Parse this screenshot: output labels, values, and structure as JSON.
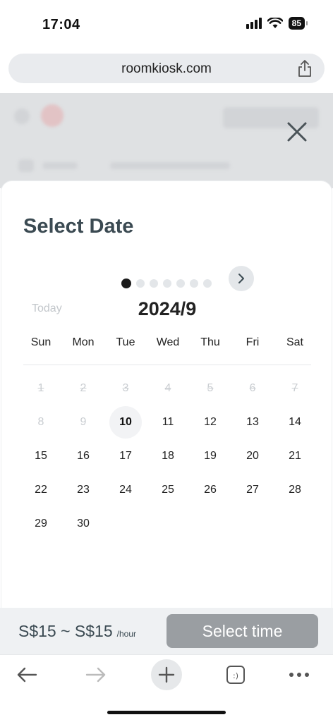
{
  "status": {
    "time": "17:04",
    "battery": "85"
  },
  "browser": {
    "url": "roomkiosk.com"
  },
  "modal": {
    "title": "Select Date",
    "today_label": "Today",
    "month": "2024/9",
    "page_dots": {
      "total": 7,
      "active_index": 0
    },
    "weekdays": [
      "Sun",
      "Mon",
      "Tue",
      "Wed",
      "Thu",
      "Fri",
      "Sat"
    ],
    "weeks": [
      [
        "1",
        "2",
        "3",
        "4",
        "5",
        "6",
        "7"
      ],
      [
        "8",
        "9",
        "10",
        "11",
        "12",
        "13",
        "14"
      ],
      [
        "15",
        "16",
        "17",
        "18",
        "19",
        "20",
        "21"
      ],
      [
        "22",
        "23",
        "24",
        "25",
        "26",
        "27",
        "28"
      ],
      [
        "29",
        "30",
        "",
        "",
        "",
        "",
        ""
      ]
    ],
    "disabled_days": [
      "1",
      "2",
      "3",
      "4",
      "5",
      "6",
      "7",
      "8",
      "9"
    ],
    "today_day": "10"
  },
  "footer": {
    "price": "S$15 ~ S$15",
    "unit": "/hour",
    "button_label": "Select time"
  },
  "colors": {
    "title_text": "#3b4a52",
    "button_disabled_bg": "#9a9ea2",
    "today_bg": "#f2f3f5"
  }
}
